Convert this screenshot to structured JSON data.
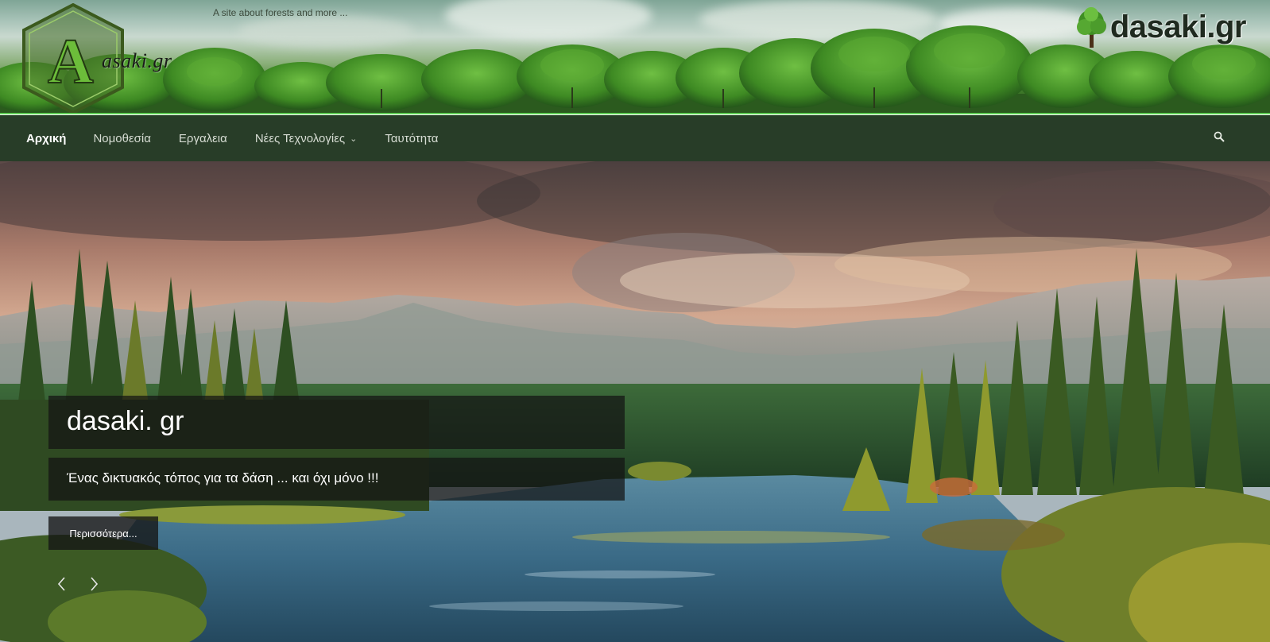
{
  "header": {
    "tagline": "A site about forests and more ...",
    "logo_left_text": "asaki.gr",
    "logo_left_letter": "A",
    "logo_right_text": "dasaki.gr"
  },
  "nav": {
    "items": [
      {
        "label": "Αρχική"
      },
      {
        "label": "Νομοθεσία"
      },
      {
        "label": "Εργαλεια"
      },
      {
        "label": "Νέες Τεχνολογίες",
        "has_dropdown": true
      },
      {
        "label": "Ταυτότητα"
      }
    ],
    "dropdown_icon": "chevron-down-icon",
    "search_icon": "search-icon"
  },
  "hero": {
    "title": "dasaki. gr",
    "subtitle": "Ένας δικτυακός τόπος για τα δάση ... και όχι μόνο !!!",
    "button_label": "Περισσότερα...",
    "prev_icon": "chevron-left-icon",
    "next_icon": "chevron-right-icon"
  },
  "colors": {
    "nav_bg": "#283d28",
    "banner_accent_line": "#5fcf56",
    "caption_bg": "rgba(20,20,20,0.72)"
  }
}
